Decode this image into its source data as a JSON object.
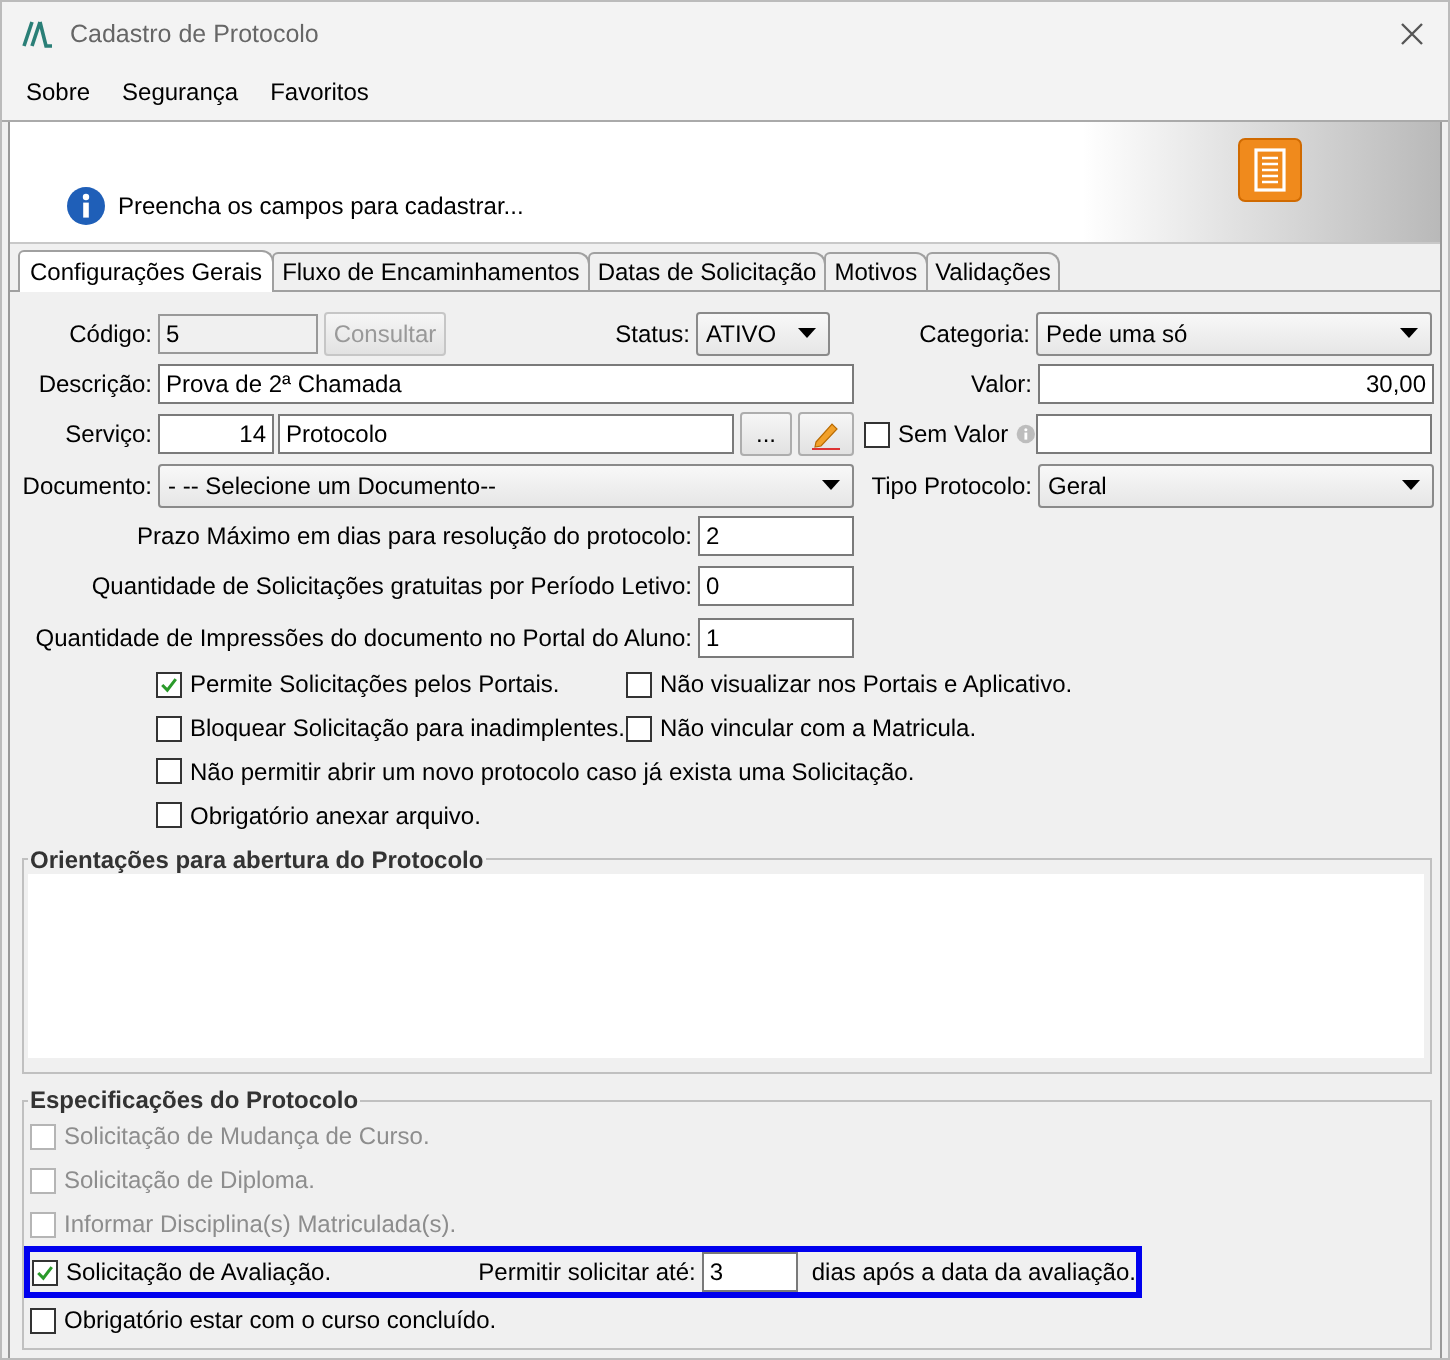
{
  "window": {
    "title": "Cadastro de Protocolo"
  },
  "menu": [
    "Sobre",
    "Segurança",
    "Favoritos"
  ],
  "banner": {
    "message": "Preencha os campos para cadastrar..."
  },
  "tabs": [
    {
      "label": "Configurações Gerais",
      "selected": true
    },
    {
      "label": "Fluxo de Encaminhamentos",
      "selected": false
    },
    {
      "label": "Datas de Solicitação",
      "selected": false
    },
    {
      "label": "Motivos",
      "selected": false
    },
    {
      "label": "Validações",
      "selected": false
    }
  ],
  "form": {
    "codigo": {
      "label": "Código:",
      "value": "5"
    },
    "consultar_button": {
      "label": "Consultar",
      "disabled": true
    },
    "status": {
      "label": "Status:",
      "value": "ATIVO"
    },
    "categoria": {
      "label": "Categoria:",
      "value": "Pede uma só"
    },
    "descricao": {
      "label": "Descrição:",
      "value": "Prova de 2ª Chamada"
    },
    "valor": {
      "label": "Valor:",
      "value": "30,00"
    },
    "servico": {
      "label": "Serviço:",
      "code": "14",
      "name": "Protocolo",
      "browse_button": "..."
    },
    "sem_valor": {
      "label": "Sem Valor",
      "checked": false
    },
    "documento": {
      "label": "Documento:",
      "value": "- -- Selecione um Documento--"
    },
    "tipo_protocolo": {
      "label": "Tipo Protocolo:",
      "value": "Geral"
    },
    "numeric_fields": [
      {
        "label": "Prazo Máximo em dias para resolução do protocolo:",
        "value": "2"
      },
      {
        "label": "Quantidade de Solicitações gratuitas por Período Letivo:",
        "value": "0"
      },
      {
        "label": "Quantidade de Impressões do documento no Portal do Aluno:",
        "value": "1"
      }
    ],
    "option_rows": [
      [
        {
          "label": "Permite Solicitações pelos Portais.",
          "checked": true
        },
        {
          "label": "Não visualizar nos Portais e Aplicativo.",
          "checked": false
        }
      ],
      [
        {
          "label": "Bloquear Solicitação para inadimplentes.",
          "checked": false
        },
        {
          "label": "Não vincular com a Matricula.",
          "checked": false
        }
      ],
      [
        {
          "label": "Não permitir abrir um novo protocolo caso já exista uma Solicitação.",
          "checked": false
        }
      ],
      [
        {
          "label": "Obrigatório anexar arquivo.",
          "checked": false
        }
      ]
    ]
  },
  "orientacoes": {
    "title": "Orientações para abertura do Protocolo"
  },
  "especificacoes": {
    "title": "Especificações do Protocolo",
    "items": [
      {
        "kind": "checkbox",
        "label": "Solicitação de Mudança de Curso.",
        "checked": false,
        "disabled": true
      },
      {
        "kind": "checkbox",
        "label": "Solicitação de Diploma.",
        "checked": false,
        "disabled": true
      },
      {
        "kind": "checkbox",
        "label": "Informar Disciplina(s) Matriculada(s).",
        "checked": false,
        "disabled": true
      },
      {
        "kind": "avaliacao",
        "label": "Solicitação de Avaliação.",
        "checked": true,
        "disabled": false,
        "highlighted": true,
        "limit_label": "Permitir solicitar até:",
        "limit_value": "3",
        "suffix": "dias após a data da avaliação."
      },
      {
        "kind": "checkbox",
        "label": "Obrigatório estar com o curso concluído.",
        "checked": false,
        "disabled": false
      }
    ]
  }
}
